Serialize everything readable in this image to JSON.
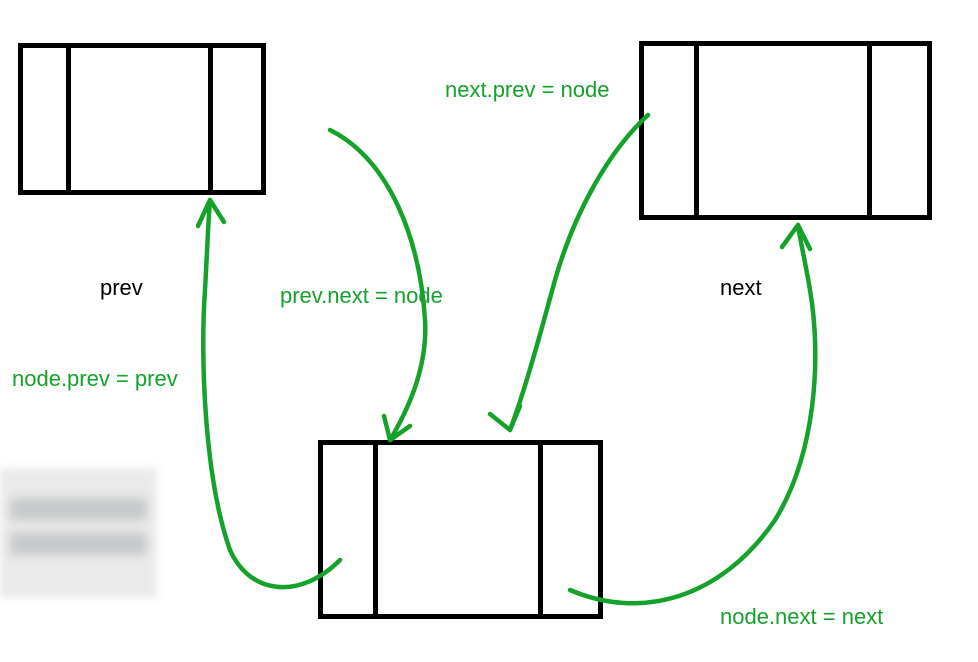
{
  "diagram": {
    "concept": "doubly-linked-list-insertion",
    "nodes": {
      "prev": {
        "label": "prev"
      },
      "next": {
        "label": "next"
      },
      "node": {
        "label": ""
      }
    },
    "annotations": {
      "next_prev_assign": "next.prev = node",
      "prev_next_assign": "prev.next = node",
      "node_prev_assign": "node.prev = prev",
      "node_next_assign": "node.next = next"
    },
    "colors": {
      "box_stroke": "#000000",
      "arrow": "#14a22a",
      "annotation_text": "#14a22a",
      "label_text": "#000000"
    }
  }
}
